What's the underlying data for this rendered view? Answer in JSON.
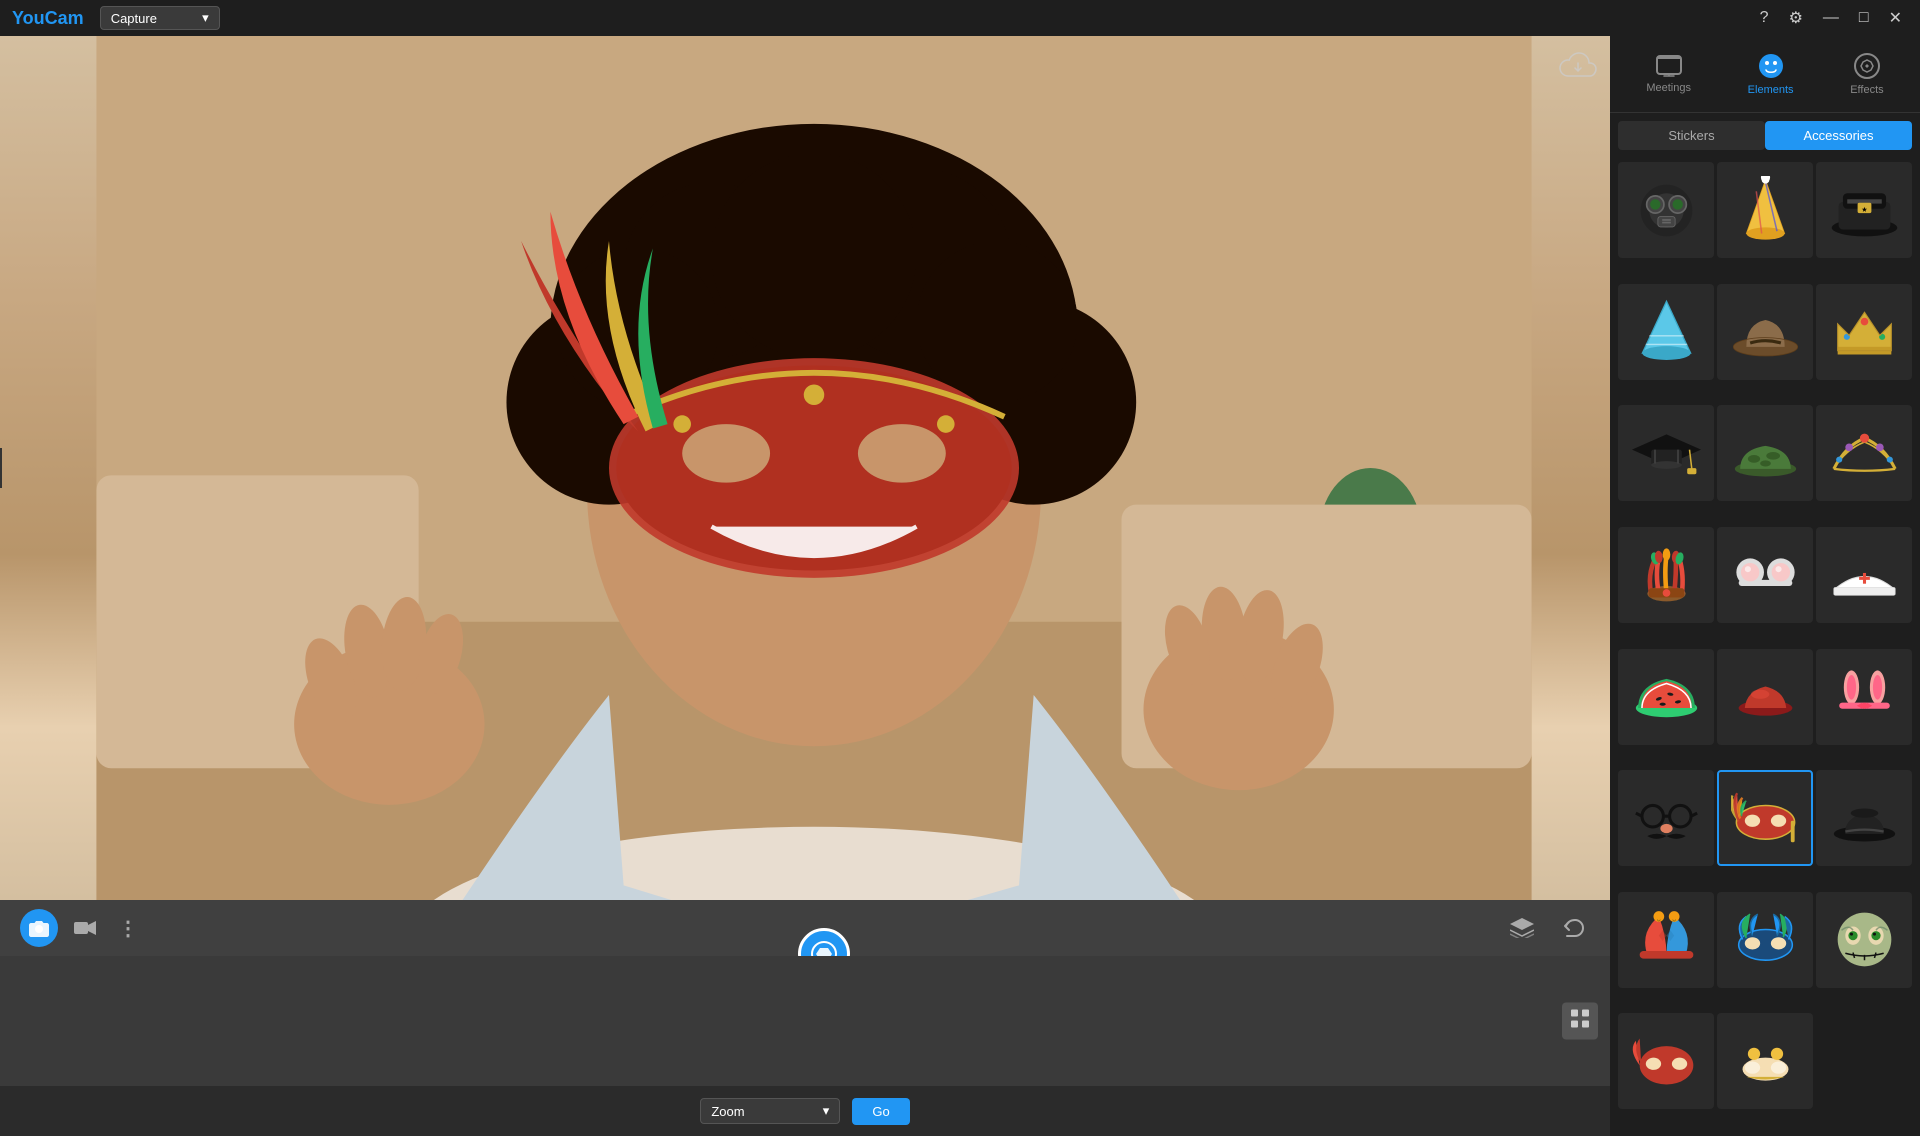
{
  "app": {
    "title": "YouCam",
    "title_color": "#2196f3"
  },
  "titlebar": {
    "capture_label": "Capture",
    "dropdown_arrow": "▾",
    "help_icon": "?",
    "settings_icon": "⚙",
    "minimize_icon": "—",
    "maximize_icon": "□",
    "close_icon": "✕"
  },
  "controls": {
    "photo_icon": "📷",
    "video_icon": "🎥",
    "more_icon": "⋮",
    "layers_icon": "⧉",
    "undo_icon": "↺"
  },
  "bottom": {
    "zoom_label": "Zoom",
    "go_label": "Go",
    "dropdown_arrow": "▾"
  },
  "right_panel": {
    "nav_items": [
      {
        "id": "meetings",
        "label": "Meetings",
        "icon": "🖼"
      },
      {
        "id": "elements",
        "label": "Elements",
        "icon": "😊"
      },
      {
        "id": "effects",
        "label": "Effects",
        "icon": "✏"
      }
    ],
    "active_nav": "elements",
    "tabs": [
      {
        "id": "stickers",
        "label": "Stickers"
      },
      {
        "id": "accessories",
        "label": "Accessories"
      }
    ],
    "active_tab": "accessories",
    "accessories": [
      {
        "id": "gas-mask",
        "type": "gas-mask",
        "selected": false
      },
      {
        "id": "party-hat",
        "type": "party-hat",
        "selected": false
      },
      {
        "id": "police-hat",
        "type": "police-hat",
        "selected": false
      },
      {
        "id": "blue-hat",
        "type": "blue-hat",
        "selected": false
      },
      {
        "id": "cowboy-hat",
        "type": "cowboy-hat",
        "selected": false
      },
      {
        "id": "gold-crown",
        "type": "gold-crown",
        "selected": false
      },
      {
        "id": "graduation-cap",
        "type": "graduation-cap",
        "selected": false
      },
      {
        "id": "army-hat",
        "type": "army-hat",
        "selected": false
      },
      {
        "id": "tiara",
        "type": "tiara",
        "selected": false
      },
      {
        "id": "indian-headdress",
        "type": "indian-headdress",
        "selected": false
      },
      {
        "id": "mouse-ears",
        "type": "mouse-ears",
        "selected": false
      },
      {
        "id": "nurse-hat",
        "type": "nurse-hat",
        "selected": false
      },
      {
        "id": "watermelon-hat",
        "type": "watermelon-hat",
        "selected": false
      },
      {
        "id": "red-hat",
        "type": "red-hat",
        "selected": false
      },
      {
        "id": "bunny-ears",
        "type": "bunny-ears",
        "selected": false
      },
      {
        "id": "groucho-glasses",
        "type": "groucho-glasses",
        "selected": false
      },
      {
        "id": "feather-mask",
        "type": "feather-mask",
        "selected": true
      },
      {
        "id": "bowler-hat",
        "type": "bowler-hat",
        "selected": false
      },
      {
        "id": "jester-hat",
        "type": "jester-hat",
        "selected": false
      },
      {
        "id": "blue-mask",
        "type": "blue-mask",
        "selected": false
      },
      {
        "id": "zombie-face",
        "type": "zombie-face",
        "selected": false
      }
    ]
  }
}
